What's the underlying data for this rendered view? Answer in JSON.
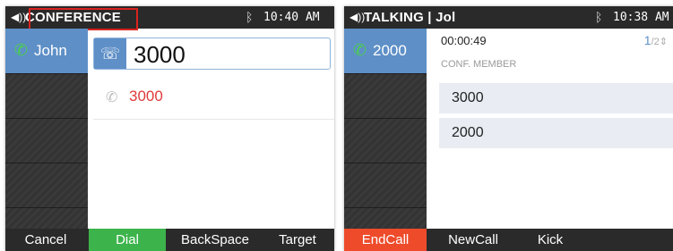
{
  "left": {
    "status_title": "CONFERENCE",
    "time": "10:40 AM",
    "line_name": "John",
    "dial_value": "3000",
    "suggestion": "3000",
    "softkeys": [
      "Cancel",
      "Dial",
      "BackSpace",
      "Target"
    ]
  },
  "right": {
    "status_title": "TALKING | Jol",
    "time": "10:38 AM",
    "line_name": "2000",
    "duration": "00:00:49",
    "page_current": "1",
    "page_total": "/2",
    "conf_label": "CONF. MEMBER",
    "members": [
      "3000",
      "2000"
    ],
    "softkeys": [
      "EndCall",
      "NewCall",
      "Kick"
    ]
  },
  "colors": {
    "accent_blue": "#5e8fc7",
    "dial_green": "#3cb44b",
    "endcall_red": "#ee4b2b",
    "highlight_red": "#d9231f"
  },
  "icons": {
    "speaker": "speaker-icon",
    "bluetooth": "bluetooth-icon",
    "phone": "phone-icon",
    "dialpad": "dialpad-icon"
  }
}
